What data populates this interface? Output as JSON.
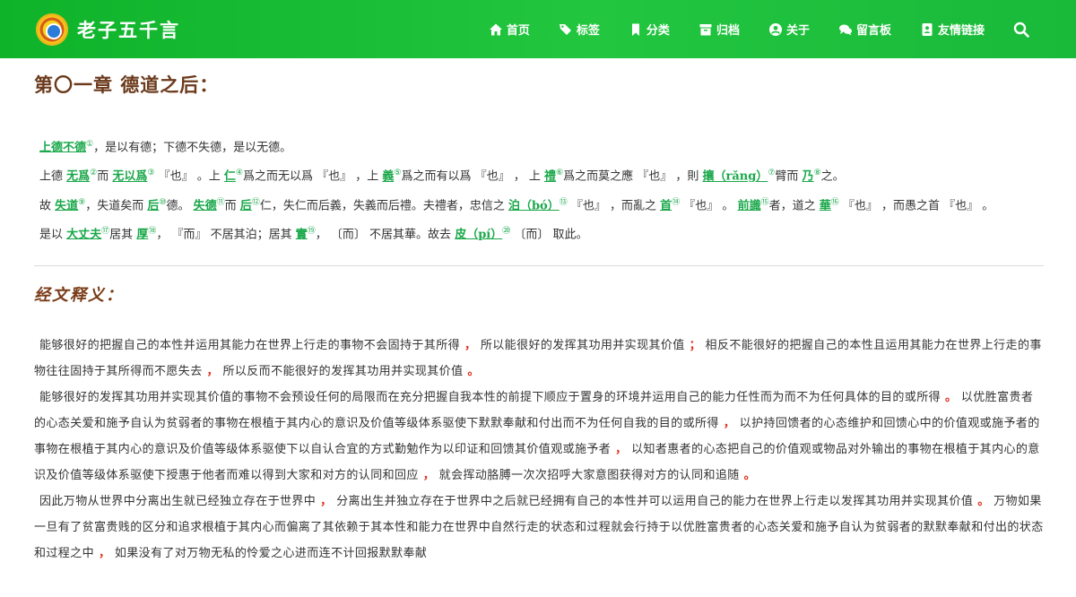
{
  "header": {
    "brand_title": "老子五千言",
    "nav": [
      {
        "label": "首页",
        "icon": "home-icon"
      },
      {
        "label": "标签",
        "icon": "tags-icon"
      },
      {
        "label": "分类",
        "icon": "bookmark-icon"
      },
      {
        "label": "归档",
        "icon": "archive-icon"
      },
      {
        "label": "关于",
        "icon": "user-circle-icon"
      },
      {
        "label": "留言板",
        "icon": "comments-icon"
      },
      {
        "label": "友情链接",
        "icon": "address-card-icon"
      }
    ],
    "search_icon": "search-icon",
    "bg_colors": [
      "#0eb32a",
      "#22c63f"
    ]
  },
  "chapter": {
    "title": "第〇一章 德道之后：",
    "verse": {
      "l1": {
        "a1": "上德不德",
        "s1": "①",
        "t1": "，是以有德；下德不失德，是以无德。"
      },
      "l2": {
        "t0": "上德 ",
        "a1": "无爲",
        "s1": "②",
        "t1": "而 ",
        "a2": "无以爲",
        "s2": "③",
        "t2": " 『也』 。上 ",
        "a3": "仁",
        "s3": "④",
        "t3": "爲之而无以爲 『也』 ，上 ",
        "a4": "義",
        "s4": "⑤",
        "t4": "爲之而有以爲 『也』 ， 上 ",
        "a5": "禮",
        "s5": "⑥",
        "t5": "爲之而莫之應 『也』 ，則 ",
        "a6": "攘（rǎng）",
        "s6": "⑦",
        "t6": "臂而 ",
        "a7": "乃",
        "s7": "⑧",
        "t7": "之。"
      },
      "l3": {
        "t0": "故 ",
        "a1": "失道",
        "s1": "⑨",
        "t1": "，失道矣而 ",
        "a2": "后",
        "s2": "⑩",
        "t2": "德。 ",
        "a3": "失德",
        "s3": "⑪",
        "t3": "而 ",
        "a4": "后",
        "s4": "⑫",
        "t4": "仁，失仁而后義，失義而后禮。夫禮者，忠信之 ",
        "a5": "泊（bó）",
        "s5": "⑬",
        "t5": " 『也』 ，而亂之 ",
        "a6": "首",
        "s6": "⑭",
        "t6": " 『也』 。 ",
        "a7": "前識",
        "s7": "⑮",
        "t7": "者，道之 ",
        "a8": "華",
        "s8": "⑯",
        "t8": " 『也』 ，而愚之首 『也』 。"
      },
      "l4": {
        "t0": "是以 ",
        "a1": "大丈夫",
        "s1": "⑰",
        "t1": "居其 ",
        "a2": "厚",
        "s2": "⑱",
        "t2": "， 『而』 不居其泊；居其 ",
        "a3": "實",
        "s3": "⑲",
        "t3": "， 〔而〕 不居其華。故去 ",
        "a4": "皮（pí）",
        "s4": "⑳",
        "t4": " 〔而〕 取此。"
      }
    }
  },
  "explanation": {
    "title": "经文释义：",
    "p1": {
      "t1": "能够很好的把握自己的本性并运用其能力在世界上行走的事物不会固持于其所得",
      "m1": " ，",
      "t2": " 所以能很好的发挥其功用并实现其价值",
      "m2": " ；",
      "t3": " 相反不能很好的把握自己的本性且运用其能力在世界上行走的事物往往固持于其所得而不愿失去",
      "m3": " ，",
      "t4": " 所以反而不能很好的发挥其功用并实现其价值",
      "m4": " 。"
    },
    "p2": {
      "t1": "能够很好的发挥其功用并实现其价值的事物不会预设任何的局限而在充分把握自我本性的前提下顺应于置身的环境并运用自己的能力任性而为而不为任何具体的目的或所得",
      "m1": " 。",
      "t2": " 以优胜富贵者的心态关爱和施予自认为贫弱者的事物在根植于其内心的意识及价值等级体系驱使下默默奉献和付出而不为任何自我的目的或所得",
      "m2": " ，",
      "t3": " 以护持回馈者的心态维护和回馈心中的价值观或施予者的事物在根植于其内心的意识及价值等级体系驱使下以自认合宜的方式勤勉作为以印证和回馈其价值观或施予者",
      "m3": " ，",
      "t4": " 以知者惠者的心态把自己的价值观或物品对外输出的事物在根植于其内心的意识及价值等级体系驱使下授惠于他者而难以得到大家和对方的认同和回应",
      "m4": " ，",
      "t5": " 就会挥动胳膊一次次招呼大家意图获得对方的认同和追随",
      "m5": " 。"
    },
    "p3": {
      "t1": "因此万物从世界中分离出生就已经独立存在于世界中",
      "m1": " ，",
      "t2": " 分离出生并独立存在于世界中之后就已经拥有自己的本性并可以运用自己的能力在世界上行走以发挥其功用并实现其价值",
      "m2": " 。",
      "t3": " 万物如果一旦有了贫富贵贱的区分和追求根植于其内心而偏离了其依赖于其本性和能力在世界中自然行走的状态和过程就会行持于以优胜富贵者的心态关爱和施予自认为贫弱者的默默奉献和付出的状态和过程之中",
      "m3": " ，",
      "t4": " 如果没有了对万物无私的怜爱之心进而连不计回报默默奉献"
    }
  }
}
